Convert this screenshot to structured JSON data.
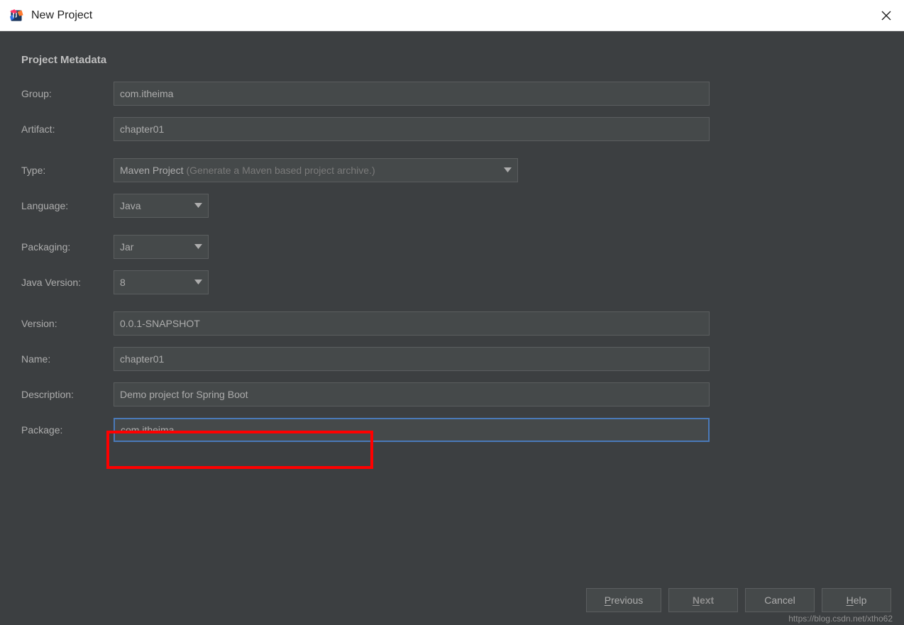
{
  "window": {
    "title": "New Project"
  },
  "section": {
    "title": "Project Metadata"
  },
  "labels": {
    "group": "Group:",
    "artifact": "Artifact:",
    "type": "Type:",
    "language": "Language:",
    "packaging": "Packaging:",
    "java_version": "Java Version:",
    "version": "Version:",
    "name": "Name:",
    "description": "Description:",
    "package": "Package:"
  },
  "values": {
    "group": "com.itheima",
    "artifact": "chapter01",
    "type_main": "Maven Project",
    "type_hint": "(Generate a Maven based project archive.)",
    "language": "Java",
    "packaging": "Jar",
    "java_version": "8",
    "version": "0.0.1-SNAPSHOT",
    "name": "chapter01",
    "description": "Demo project for Spring Boot",
    "package": "com.itheima"
  },
  "buttons": {
    "previous": "revious",
    "previous_u": "P",
    "next": "ext",
    "next_u": "N",
    "cancel": "Cancel",
    "help": "elp",
    "help_u": "H"
  },
  "watermark": "https://blog.csdn.net/xtho62"
}
